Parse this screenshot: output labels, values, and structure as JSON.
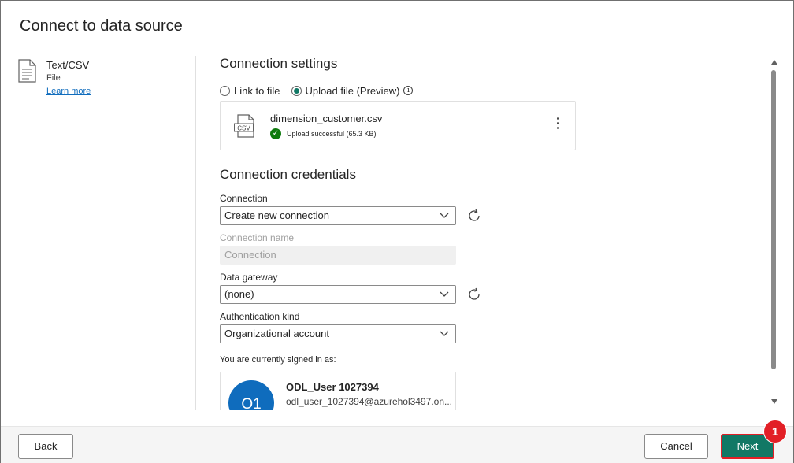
{
  "dialog": {
    "title": "Connect to data source"
  },
  "source": {
    "name": "Text/CSV",
    "type": "File",
    "learn_more": "Learn more"
  },
  "settings": {
    "heading": "Connection settings",
    "radio_link": "Link to file",
    "radio_upload": "Upload file (Preview)",
    "selected": "Upload file (Preview)",
    "file": {
      "icon_label": "CSV",
      "name": "dimension_customer.csv",
      "status": "Upload successful (65.3 KB)"
    }
  },
  "credentials": {
    "heading": "Connection credentials",
    "connection_label": "Connection",
    "connection_value": "Create new connection",
    "connection_name_label": "Connection name",
    "connection_name_placeholder": "Connection",
    "gateway_label": "Data gateway",
    "gateway_value": "(none)",
    "auth_label": "Authentication kind",
    "auth_value": "Organizational account",
    "signed_in_label": "You are currently signed in as:",
    "user": {
      "initials": "O1",
      "name": "ODL_User 1027394",
      "email": "odl_user_1027394@azurehol3497.on..."
    }
  },
  "footer": {
    "back": "Back",
    "cancel": "Cancel",
    "next": "Next",
    "step_badge": "1"
  },
  "colors": {
    "accent": "#117865",
    "highlight": "#e21f26",
    "avatar": "#0f6cbd",
    "success": "#0e7a0d"
  }
}
